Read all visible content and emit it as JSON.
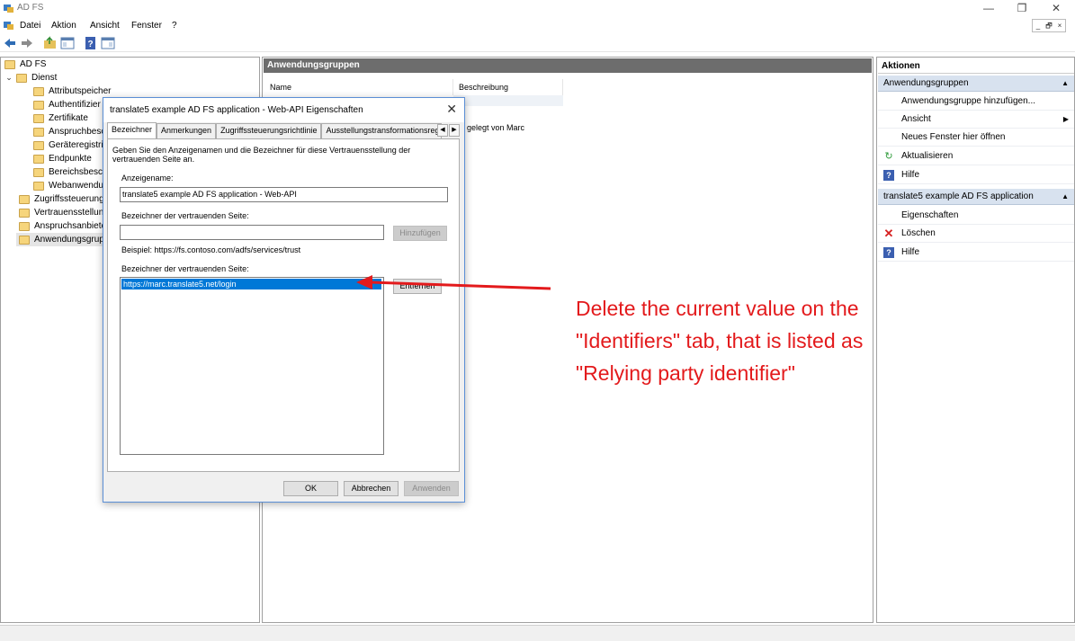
{
  "window": {
    "title": "AD FS",
    "buttons": [
      "—",
      "❐",
      "✕"
    ]
  },
  "menu": {
    "items": [
      "Datei",
      "Aktion",
      "Ansicht",
      "Fenster",
      "?"
    ],
    "mdi_buttons": [
      "_",
      "🗗",
      "×"
    ]
  },
  "tree": {
    "root": "AD FS",
    "dienst": "Dienst",
    "children": [
      "Attributspeicher",
      "Authentifizier",
      "Zertifikate",
      "Anspruchbesc",
      "Geräteregistri",
      "Endpunkte",
      "Bereichsbesch",
      "Webanwendu"
    ],
    "siblings": [
      "Zugriffssteuerung",
      "Vertrauensstellun",
      "Anspruchsanbiete",
      "Anwendungsgrup"
    ]
  },
  "center": {
    "title": "Anwendungsgruppen",
    "columns": [
      "Name",
      "Beschreibung"
    ],
    "row_partial": "gelegt von Marc"
  },
  "actions": {
    "title": "Aktionen",
    "section1": "Anwendungsgruppen",
    "section1_items": [
      "Anwendungsgruppe hinzufügen...",
      "Ansicht",
      "Neues Fenster hier öffnen",
      "Aktualisieren",
      "Hilfe"
    ],
    "section2": "translate5 example AD FS application",
    "section2_items": [
      "Eigenschaften",
      "Löschen",
      "Hilfe"
    ]
  },
  "dialog": {
    "title": "translate5 example AD FS application - Web-API Eigenschaften",
    "tabs": [
      "Bezeichner",
      "Anmerkungen",
      "Zugriffssteuerungsrichtlinie",
      "Ausstellungstransformationsregeln"
    ],
    "description": "Geben Sie den Anzeigenamen und die Bezeichner für diese Vertrauensstellung der vertrauenden Seite an.",
    "display_name_label": "Anzeigename:",
    "display_name_value": "translate5 example AD FS application - Web-API",
    "rp_identifier_label": "Bezeichner der vertrauenden Seite:",
    "rp_identifier_value": "",
    "add_button": "Hinzufügen",
    "example": "Beispiel: https://fs.contoso.com/adfs/services/trust",
    "rp_identifiers_label": "Bezeichner der vertrauenden Seite:",
    "identifiers": [
      "https://marc.translate5.net/login"
    ],
    "remove_button": "Entfernen",
    "ok_button": "OK",
    "cancel_button": "Abbrechen",
    "apply_button": "Anwenden"
  },
  "annotation": {
    "lines": [
      "Delete the current value on the",
      "\"Identifiers\" tab, that is listed as",
      "\"Relying party identifier\""
    ],
    "color": "#e31a1c"
  }
}
